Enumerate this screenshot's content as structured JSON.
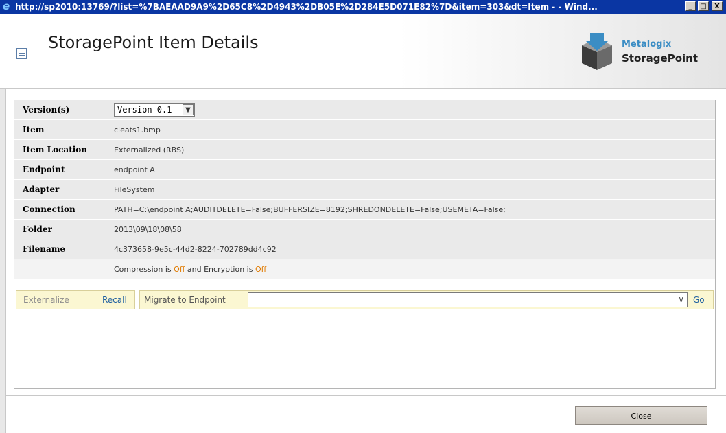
{
  "window": {
    "title": "http://sp2010:13769/?list=%7BAEAAD9A9%2D65C8%2D4943%2DB05E%2D284E5D071E82%7D&item=303&dt=Item - - Wind...",
    "minimize_glyph": "_",
    "maximize_glyph": "□",
    "close_glyph": "X"
  },
  "header": {
    "title": "StoragePoint Item Details",
    "logo_brand": "Metalogix",
    "logo_product": "StoragePoint"
  },
  "details": {
    "version_label": "Version(s)",
    "version_selected": "Version 0.1",
    "rows": [
      {
        "label": "Item",
        "value": "cleats1.bmp"
      },
      {
        "label": "Item Location",
        "value": "Externalized (RBS)"
      },
      {
        "label": "Endpoint",
        "value": "endpoint A"
      },
      {
        "label": "Adapter",
        "value": "FileSystem"
      },
      {
        "label": "Connection",
        "value": "PATH=C:\\endpoint A;AUDITDELETE=False;BUFFERSIZE=8192;SHREDONDELETE=False;USEMETA=False;"
      },
      {
        "label": "Folder",
        "value": "2013\\09\\18\\08\\58"
      },
      {
        "label": "Filename",
        "value": "4c373658-9e5c-44d2-8224-702789dd4c92"
      }
    ],
    "status": {
      "compression_prefix": "Compression is ",
      "compression_value": "Off",
      "encryption_prefix": " and Encryption is ",
      "encryption_value": "Off"
    }
  },
  "actions": {
    "externalize": "Externalize",
    "recall": "Recall",
    "migrate_label": "Migrate to Endpoint",
    "migrate_selected": "",
    "go": "Go"
  },
  "footer": {
    "close": "Close"
  },
  "colors": {
    "titlebar": "#0a36a3",
    "off_highlight": "#e07a00",
    "action_bg": "#fbf7d2",
    "link": "#2060a0",
    "brand": "#3b8dc4"
  }
}
